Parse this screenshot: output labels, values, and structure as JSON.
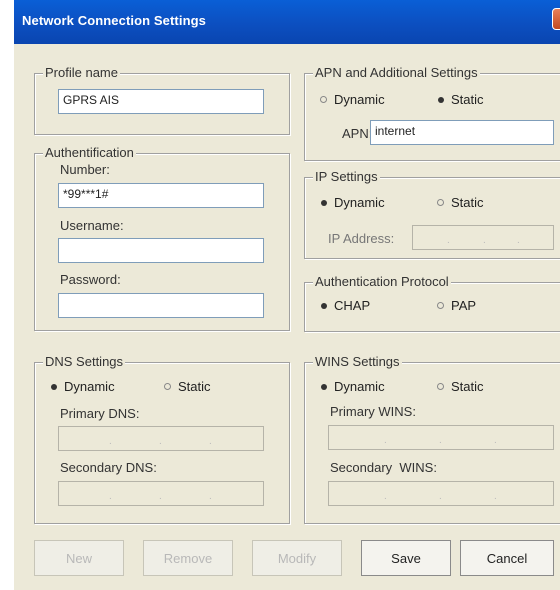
{
  "window": {
    "title": "Network Connection Settings"
  },
  "profile": {
    "legend": "Profile name",
    "value": "GPRS AIS"
  },
  "authentication": {
    "legend": "Authentification",
    "number_label": "Number:",
    "number_value": "*99***1#",
    "username_label": "Username:",
    "username_value": "",
    "password_label": "Password:",
    "password_value": ""
  },
  "apn": {
    "legend": "APN and Additional Settings",
    "dynamic": "Dynamic",
    "static": "Static",
    "selected": "static",
    "apn_label": "APN:",
    "apn_value": "internet"
  },
  "ip": {
    "legend": "IP Settings",
    "dynamic": "Dynamic",
    "static": "Static",
    "selected": "dynamic",
    "address_label": "IP Address:"
  },
  "auth_protocol": {
    "legend": "Authentication Protocol",
    "chap": "CHAP",
    "pap": "PAP",
    "selected": "chap"
  },
  "dns": {
    "legend": "DNS Settings",
    "dynamic": "Dynamic",
    "static": "Static",
    "selected": "dynamic",
    "primary_label": "Primary DNS:",
    "secondary_label": "Secondary DNS:"
  },
  "wins": {
    "legend": "WINS Settings",
    "dynamic": "Dynamic",
    "static": "Static",
    "selected": "dynamic",
    "primary_label": "Primary WINS:",
    "secondary_label": "Secondary  WINS:"
  },
  "buttons": {
    "new": "New",
    "remove": "Remove",
    "modify": "Modify",
    "save": "Save",
    "cancel": "Cancel"
  }
}
